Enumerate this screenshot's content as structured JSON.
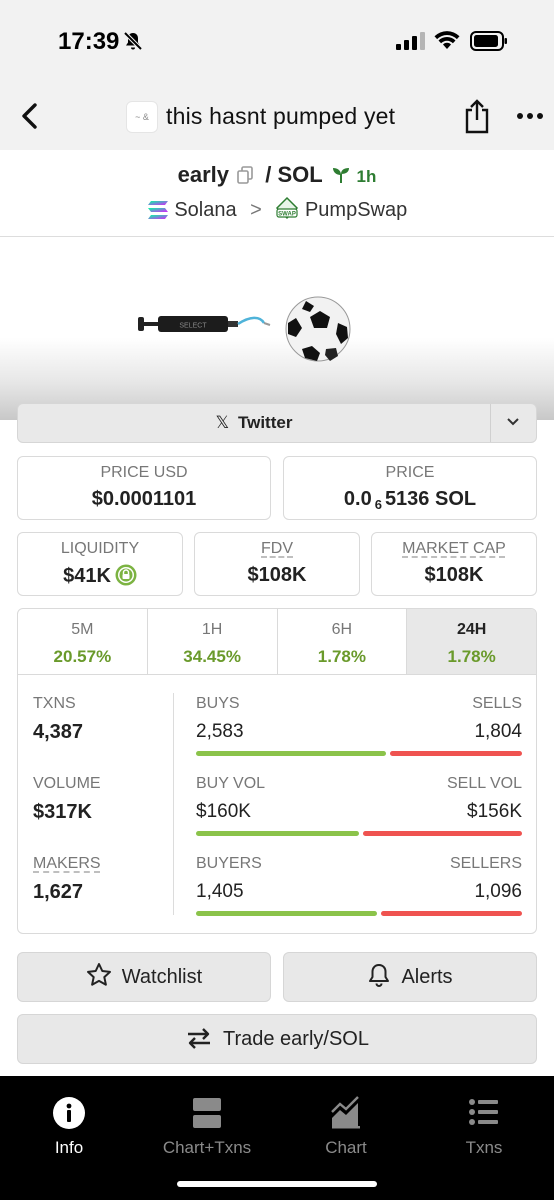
{
  "status": {
    "time": "17:39"
  },
  "nav": {
    "title": "this hasnt pumped yet",
    "logo_text": "~ &"
  },
  "pair": {
    "base": "early",
    "quote": "/ SOL",
    "age": "1h"
  },
  "chain": {
    "name": "Solana",
    "dex": "PumpSwap",
    "dex_badge": "SWAP"
  },
  "banner": {
    "pump_text": "SELECT"
  },
  "twitter": {
    "label": "Twitter",
    "x_glyph": "𝕏"
  },
  "price_usd": {
    "label": "PRICE USD",
    "value": "$0.0001101"
  },
  "price_native": {
    "label": "PRICE",
    "prefix": "0.0",
    "subscript": "6",
    "suffix": "5136 SOL"
  },
  "liquidity": {
    "label": "LIQUIDITY",
    "value": "$41K"
  },
  "fdv": {
    "label": "FDV",
    "value": "$108K"
  },
  "market_cap": {
    "label": "MARKET CAP",
    "value": "$108K"
  },
  "timeframes": [
    {
      "label": "5M",
      "value": "20.57%"
    },
    {
      "label": "1H",
      "value": "34.45%"
    },
    {
      "label": "6H",
      "value": "1.78%"
    },
    {
      "label": "24H",
      "value": "1.78%"
    }
  ],
  "stats": {
    "txns": {
      "label": "TXNS",
      "value": "4,387"
    },
    "volume": {
      "label": "VOLUME",
      "value": "$317K"
    },
    "makers": {
      "label": "MAKERS",
      "value": "1,627"
    },
    "buys": {
      "left_label": "BUYS",
      "left_value": "2,583",
      "right_label": "SELLS",
      "right_value": "1,804",
      "buy_fraction": 0.589
    },
    "vol": {
      "left_label": "BUY VOL",
      "left_value": "$160K",
      "right_label": "SELL VOL",
      "right_value": "$156K",
      "buy_fraction": 0.506
    },
    "buyers": {
      "left_label": "BUYERS",
      "left_value": "1,405",
      "right_label": "SELLERS",
      "right_value": "1,096",
      "buy_fraction": 0.562
    }
  },
  "actions": {
    "watchlist": "Watchlist",
    "alerts": "Alerts",
    "trade": "Trade early/SOL"
  },
  "tabs": [
    {
      "label": "Info",
      "icon": "info-icon"
    },
    {
      "label": "Chart+Txns",
      "icon": "chart-txns-icon"
    },
    {
      "label": "Chart",
      "icon": "chart-icon"
    },
    {
      "label": "Txns",
      "icon": "txns-icon"
    }
  ],
  "colors": {
    "positive": "#6a9a2b",
    "buy_bar": "#8bc34a",
    "sell_bar": "#ef5350",
    "age": "#2e7d32"
  }
}
